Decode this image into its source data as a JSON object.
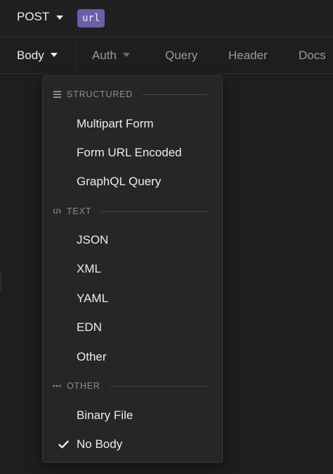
{
  "url_bar": {
    "method": "POST",
    "url_tag": "url"
  },
  "tabs": [
    {
      "label": "Body",
      "active": true,
      "has_caret": true
    },
    {
      "label": "Auth",
      "active": false,
      "has_caret": true
    },
    {
      "label": "Query",
      "active": false
    },
    {
      "label": "Header",
      "active": false
    },
    {
      "label": "Docs",
      "active": false
    }
  ],
  "dropdown": {
    "sections": [
      {
        "title": "STRUCTURED",
        "icon": "bars-icon",
        "items": [
          "Multipart Form",
          "Form URL Encoded",
          "GraphQL Query"
        ]
      },
      {
        "title": "TEXT",
        "icon": "code-icon",
        "items": [
          "JSON",
          "XML",
          "YAML",
          "EDN",
          "Other"
        ]
      },
      {
        "title": "OTHER",
        "icon": "dots-icon",
        "items": [
          "Binary File",
          "No Body"
        ]
      }
    ],
    "selected": "No Body"
  },
  "colors": {
    "background": "#1e1e20",
    "menu_bg": "#262628",
    "url_tag": "#6b5fa8",
    "text": "#ececee",
    "muted": "#8d8d93"
  }
}
